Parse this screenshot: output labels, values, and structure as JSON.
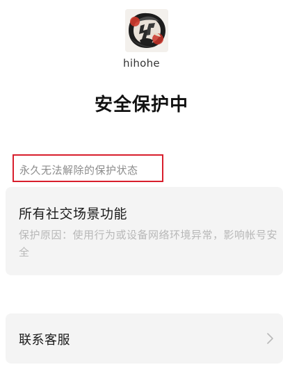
{
  "profile": {
    "username": "hihohe",
    "avatar_icon": "ink-art-avatar-icon"
  },
  "page": {
    "title": "安全保护中"
  },
  "status": {
    "label": "永久无法解除的保护状态",
    "highlight_color": "#d81e2c"
  },
  "protection_card": {
    "title": "所有社交场景功能",
    "reason": "保护原因：使用行为或设备网络环境异常，影响帐号安全"
  },
  "service": {
    "label": "联系客服",
    "icon": "chevron-right-icon"
  },
  "colors": {
    "background": "#ffffff",
    "card_background": "#f4f4f4",
    "muted_text": "#b8b8b8"
  }
}
